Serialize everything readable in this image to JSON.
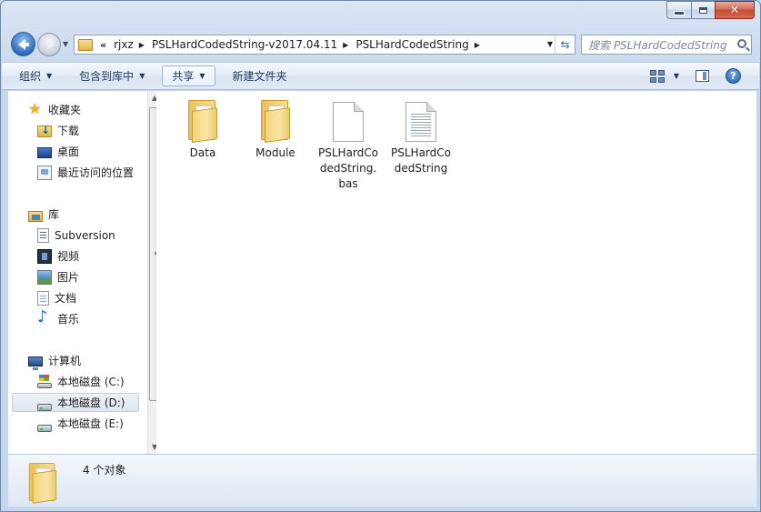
{
  "window": {
    "caption": {
      "minimize_symbol": "",
      "maximize_symbol": "",
      "close_symbol": "✕"
    }
  },
  "address": {
    "overflow": "«",
    "crumbs": [
      "rjxz",
      "PSLHardCodedString-v2017.04.11",
      "PSLHardCodedString"
    ]
  },
  "search": {
    "placeholder": "搜索 PSLHardCodedString"
  },
  "toolbar": {
    "organize": "组织",
    "include_library": "包含到库中",
    "share": "共享",
    "new_folder": "新建文件夹"
  },
  "nav": {
    "favorites": "收藏夹",
    "downloads": "下载",
    "desktop": "桌面",
    "recent": "最近访问的位置",
    "libraries": "库",
    "subversion": "Subversion",
    "videos": "视频",
    "pictures": "图片",
    "documents": "文档",
    "music": "音乐",
    "computer": "计算机",
    "drive_c": "本地磁盘 (C:)",
    "drive_d": "本地磁盘 (D:)",
    "drive_e": "本地磁盘 (E:)"
  },
  "files": [
    {
      "name": "Data",
      "icon": "folder-icon"
    },
    {
      "name": "Module",
      "icon": "folder-icon"
    },
    {
      "name": "PSLHardCodedString.bas",
      "icon": "file-icon"
    },
    {
      "name": "PSLHardCodedString",
      "icon": "text-file-icon"
    }
  ],
  "details": {
    "count_text": "4 个对象"
  },
  "colors": {
    "accent": "#1e395b",
    "selected_bg": "#dfe6ef",
    "window_frame": "#c6d6eb"
  }
}
